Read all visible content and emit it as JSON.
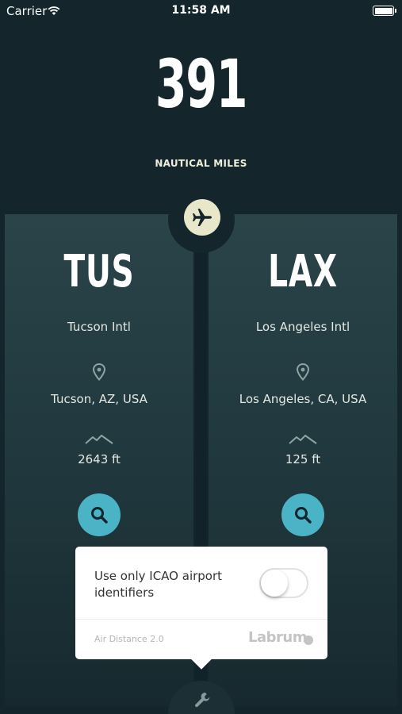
{
  "status_bar": {
    "carrier": "Carrier",
    "time": "11:58 AM"
  },
  "distance": {
    "value": "391",
    "unit": "NAUTICAL MILES"
  },
  "origin": {
    "code": "TUS",
    "name": "Tucson Intl",
    "location": "Tucson, AZ, USA",
    "elevation": "2643 ft"
  },
  "destination": {
    "code": "LAX",
    "name": "Los Angeles Intl",
    "location": "Los Angeles, CA, USA",
    "elevation": "125 ft"
  },
  "settings_popup": {
    "icao_label": "Use only ICAO airport identifiers",
    "icao_enabled": false,
    "version": "Air Distance 2.0",
    "brand": "Labrum"
  },
  "colors": {
    "background": "#14262b",
    "accent": "#4ab3c6",
    "plane_button": "#e8e7c9"
  },
  "icons": {
    "plane": "airplane-icon",
    "pin": "map-pin-icon",
    "elevation": "mountain-icon",
    "search": "search-icon",
    "wrench": "wrench-icon"
  }
}
